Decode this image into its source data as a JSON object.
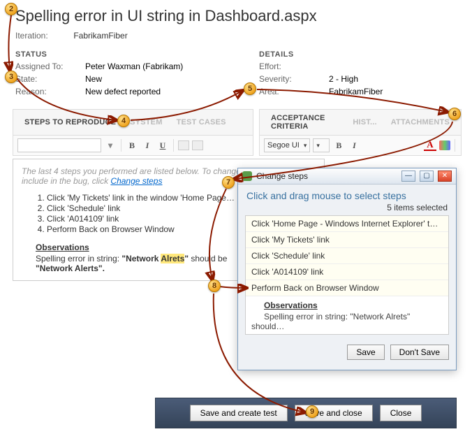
{
  "title": "Spelling error in UI string in Dashboard.aspx",
  "iteration": {
    "label": "Iteration:",
    "value": "FabrikamFiber"
  },
  "status": {
    "header": "STATUS",
    "assigned_to": {
      "k": "Assigned To:",
      "v": "Peter Waxman (Fabrikam)"
    },
    "state": {
      "k": "State:",
      "v": "New"
    },
    "reason": {
      "k": "Reason:",
      "v": "New defect reported"
    }
  },
  "details": {
    "header": "DETAILS",
    "effort": {
      "k": "Effort:",
      "v": ""
    },
    "severity": {
      "k": "Severity:",
      "v": "2 - High"
    },
    "area": {
      "k": "Area:",
      "v": "FabrikamFiber"
    }
  },
  "tabs_left": {
    "steps": "STEPS TO REPRODUCE",
    "system": "SYSTEM",
    "tests": "TEST CASES"
  },
  "tabs_right": {
    "accept": "ACCEPTANCE CRITERIA",
    "hist": "HIST...",
    "attach": "ATTACHMENTS"
  },
  "toolbar_right": {
    "font": "Segoe UI"
  },
  "repro": {
    "hint_prefix": "The last 4 steps you performed are listed below. To change which steps to include in the bug, click ",
    "hint_link": "Change steps",
    "steps": [
      "Click 'My Tickets' link in the window 'Home Page…",
      "Click 'Schedule' link",
      "Click 'A014109' link",
      "Perform Back on Browser Window"
    ],
    "obs_header": "Observations",
    "obs_line_a": "Spelling error in string: ",
    "obs_bold_a": "\"Network ",
    "obs_hl": "Alrets",
    "obs_bold_b": "\"",
    "obs_tail": " should be ",
    "obs_line_b": "\"Network Alerts\"."
  },
  "dialog": {
    "title": "Change steps",
    "subtitle": "Click and drag mouse to select steps",
    "count": "5 items selected",
    "rows": [
      "Click 'Home Page - Windows Internet Explorer' t…",
      "Click 'My Tickets' link",
      "Click 'Schedule' link",
      "Click 'A014109' link",
      "Perform Back on Browser Window"
    ],
    "obs_header": "Observations",
    "obs_body": "Spelling error in string: \"Network Alrets\" should…",
    "save": "Save",
    "dont_save": "Don't Save"
  },
  "bottom": {
    "save_test": "Save and create test",
    "save_close": "Save and close",
    "close": "Close"
  },
  "callouts": {
    "c2": "2",
    "c3": "3",
    "c4": "4",
    "c5": "5",
    "c6": "6",
    "c7": "7",
    "c8": "8",
    "c9": "9"
  }
}
